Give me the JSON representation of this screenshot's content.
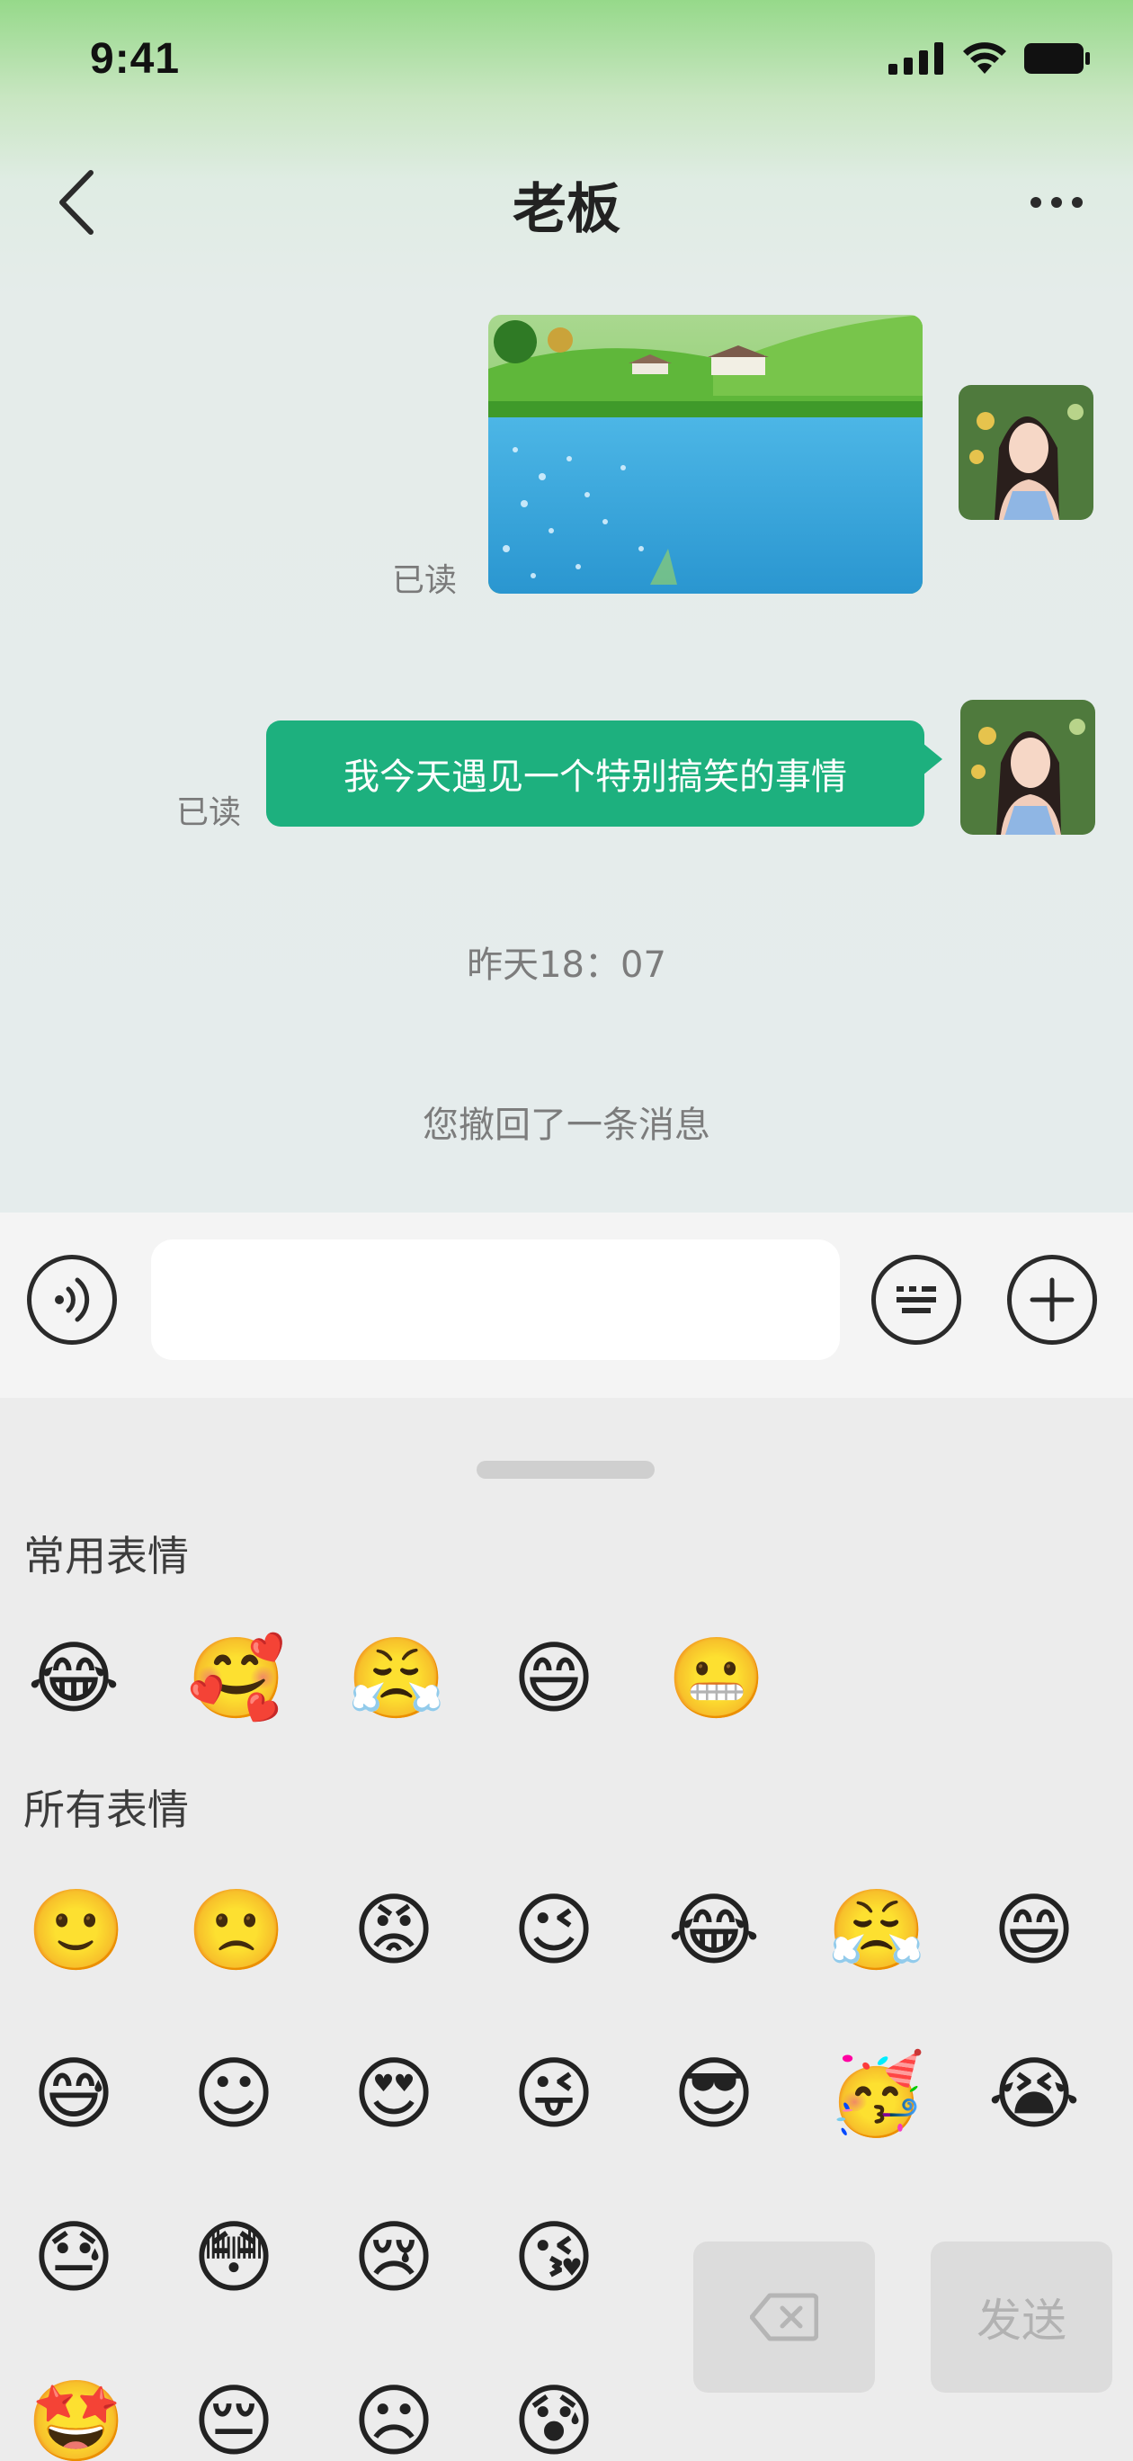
{
  "status_bar": {
    "time": "9:41"
  },
  "header": {
    "title": "老板"
  },
  "messages": {
    "image_read_status": "已读",
    "text_read_status": "已读",
    "text_message": "我今天遇见一个特别搞笑的事情",
    "timestamp": "昨天18：07",
    "recall_notice": "您撤回了一条消息"
  },
  "input": {
    "value": "",
    "placeholder": ""
  },
  "emoji_panel": {
    "frequent_title": "常用表情",
    "all_title": "所有表情",
    "frequent": [
      "😂",
      "🥰",
      "😤",
      "😄",
      "😬"
    ],
    "all_rows": [
      [
        "🙂",
        "🙁",
        "😡",
        "😉",
        "😂",
        "😤",
        "😄"
      ],
      [
        "😅",
        "☺",
        "😍",
        "😜",
        "😎",
        "🥳",
        "😭"
      ],
      [
        "😓",
        "😳",
        "😢",
        "😘"
      ],
      [
        "🤩",
        "😔",
        "☹",
        "😰"
      ]
    ],
    "send_label": "发送"
  },
  "colors": {
    "bubble": "#1db07e",
    "accent_green": "#96d98a"
  }
}
